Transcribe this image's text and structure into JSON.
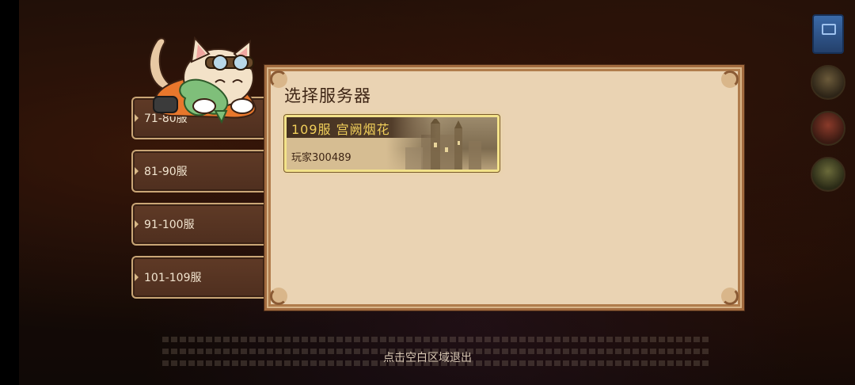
{
  "server_groups": [
    {
      "label": "71-80服"
    },
    {
      "label": "81-90服"
    },
    {
      "label": "91-100服"
    },
    {
      "label": "101-109服"
    }
  ],
  "panel": {
    "title": "选择服务器",
    "server": {
      "name": "109服  宫阙烟花",
      "player": "玩家300489"
    }
  },
  "exit_hint": "点击空白区域退出",
  "colors": {
    "panel_bg": "#ead3b3",
    "tab_bg": "#5a3623",
    "server_title": "#f1cf5a",
    "selected_glow": "#f3e28a"
  },
  "icons": {
    "mascot": "cat-pilot-mascot",
    "side": [
      "guide-book-icon",
      "avatar-icon",
      "gift-icon",
      "character-icon"
    ]
  }
}
